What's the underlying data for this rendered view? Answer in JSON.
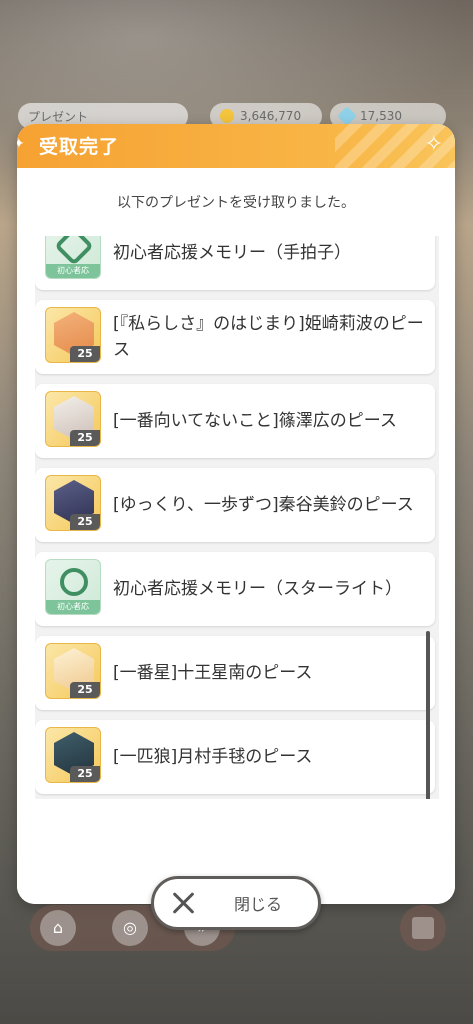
{
  "background": {
    "present_tab_label": "プレゼント",
    "coins_value": "3,646,770",
    "gems_value": "17,530"
  },
  "dialog": {
    "title": "受取完了",
    "subtitle": "以下のプレゼントを受け取りました。",
    "items": [
      {
        "type": "memory",
        "text": "初心者応援メモリー（手拍子）",
        "thumb_label": "初心者応"
      },
      {
        "type": "piece",
        "text": "[『私らしさ』のはじまり]姫崎莉波のピース",
        "count": "25"
      },
      {
        "type": "piece",
        "text": "[一番向いてないこと]篠澤広のピース",
        "count": "25"
      },
      {
        "type": "piece",
        "text": "[ゆっくり、一歩ずつ]秦谷美鈴のピース",
        "count": "25"
      },
      {
        "type": "memory",
        "text": "初心者応援メモリー（スターライト）",
        "thumb_label": "初心者応"
      },
      {
        "type": "piece",
        "text": "[一番星]十王星南のピース",
        "count": "25"
      },
      {
        "type": "piece",
        "text": "[一匹狼]月村手毬のピース",
        "count": "25"
      }
    ],
    "close_label": "閉じる"
  },
  "colors": {
    "header_orange": "#f6a233",
    "piece_gold": "#f5c85a",
    "memory_green": "#7ec49a"
  }
}
